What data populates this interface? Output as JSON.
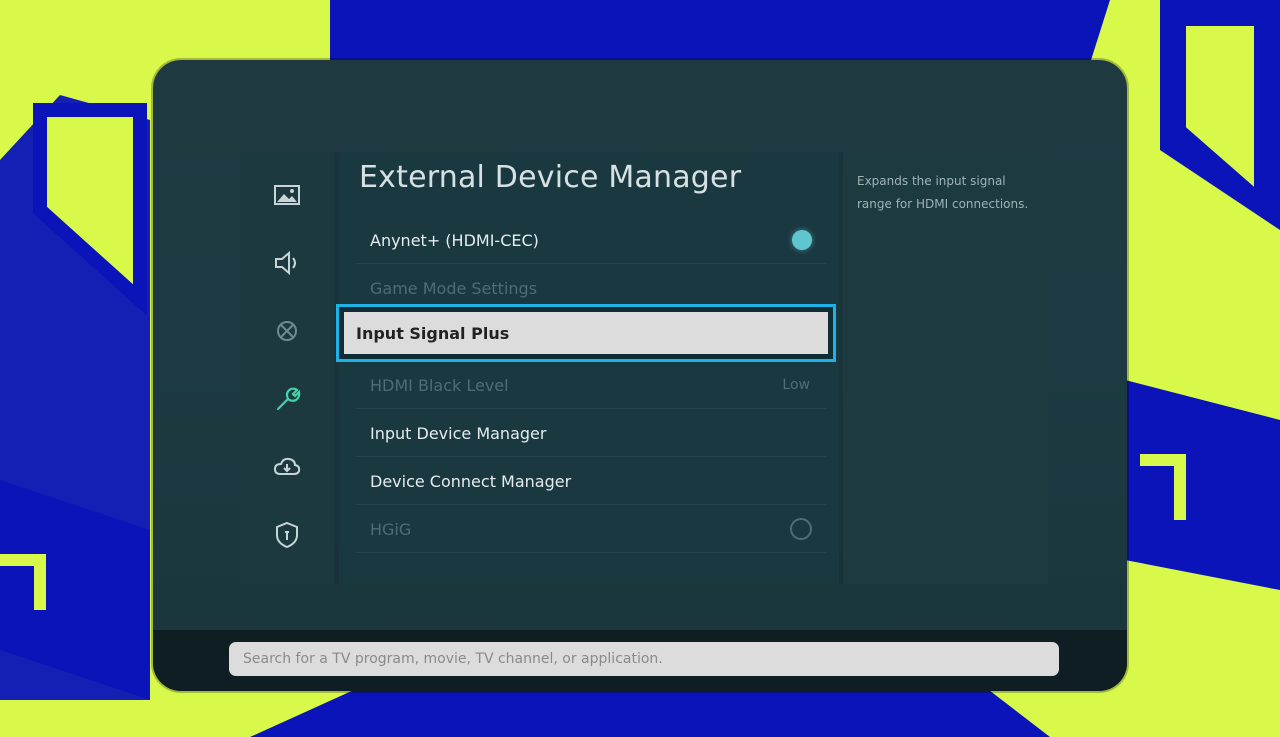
{
  "colors": {
    "background_lime": "#d8f84a",
    "background_blue": "#0a14b8",
    "focus_border": "#1fb2e6",
    "toggle_on": "#5fc6cf"
  },
  "sidebar": {
    "icons": [
      {
        "name": "picture-icon"
      },
      {
        "name": "sound-icon"
      },
      {
        "name": "broadcasting-icon"
      },
      {
        "name": "general-wrench-icon",
        "selected": true
      },
      {
        "name": "support-cloud-icon"
      },
      {
        "name": "privacy-shield-icon"
      }
    ]
  },
  "menu": {
    "title": "External Device Manager",
    "items": [
      {
        "label": "Anynet+ (HDMI-CEC)",
        "toggle": "on",
        "enabled": true
      },
      {
        "label": "Game Mode Settings",
        "enabled": false
      },
      {
        "label": "Input Signal Plus",
        "enabled": true,
        "focused": true
      },
      {
        "label": "HDMI Black Level",
        "value": "Low",
        "enabled": false
      },
      {
        "label": "Input Device Manager",
        "enabled": true
      },
      {
        "label": "Device Connect Manager",
        "enabled": true
      },
      {
        "label": "HGiG",
        "toggle": "off",
        "enabled": false
      }
    ]
  },
  "help": {
    "text": "Expands the input signal range for HDMI connections."
  },
  "search": {
    "placeholder": "Search for a TV program, movie, TV channel, or application."
  }
}
